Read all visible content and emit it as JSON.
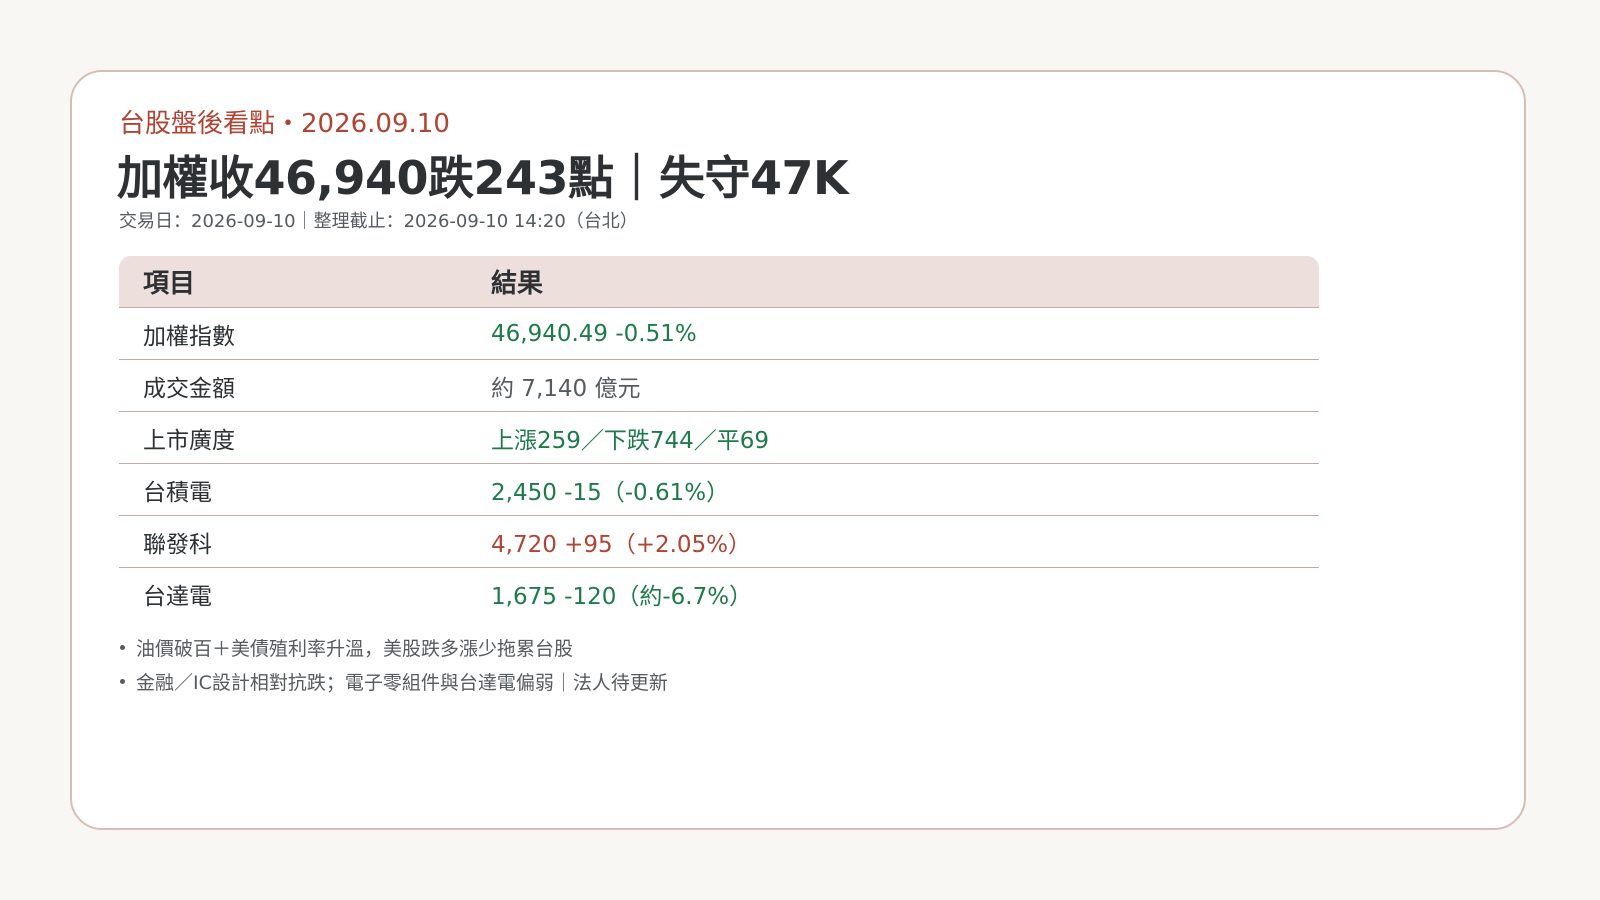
{
  "kicker": "台股盤後看點・2026.09.10",
  "headline": "加權收46,940跌243點｜失守47K",
  "meta": "交易日：2026-09-10｜整理截止：2026-09-10 14:20（台北）",
  "table": {
    "headers": [
      "項目",
      "結果"
    ],
    "rows": [
      {
        "label": "加權指數",
        "value": "46,940.49  -0.51%",
        "color": "#1e7a4a"
      },
      {
        "label": "成交金額",
        "value": "約 7,140 億元",
        "color": "#565b5f"
      },
      {
        "label": "上市廣度",
        "value": "上漲259／下跌744／平69",
        "color": "#1e7a4a"
      },
      {
        "label": "台積電",
        "value": "2,450  -15（-0.61%）",
        "color": "#1e7a4a"
      },
      {
        "label": "聯發科",
        "value": "4,720  +95（+2.05%）",
        "color": "#b04434"
      },
      {
        "label": "台達電",
        "value": "1,675  -120（約-6.7%）",
        "color": "#1e7a4a"
      }
    ]
  },
  "notes": [
    "油價破百＋美債殖利率升溫，美股跌多漲少拖累台股",
    "金融／IC設計相對抗跌；電子零組件與台達電偏弱｜法人待更新"
  ],
  "colors": {
    "accent": "#b04434",
    "down_green": "#1e7a4a",
    "header_bg": "#eddfdb",
    "card_border": "#d8bdb4"
  }
}
